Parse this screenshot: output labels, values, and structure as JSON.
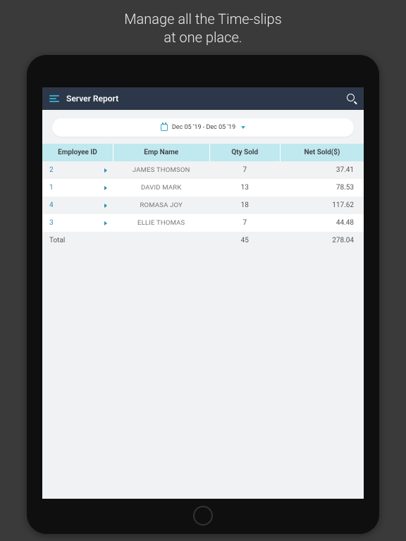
{
  "promo": {
    "line1": "Manage all the Time-slips",
    "line2": "at one place."
  },
  "topbar": {
    "title": "Server Report"
  },
  "dateRange": {
    "text": "Dec 05 '19 - Dec 05 '19"
  },
  "table": {
    "headers": {
      "id": "Employee ID",
      "name": "Emp Name",
      "qty": "Qty Sold",
      "net": "Net Sold($)"
    },
    "rows": [
      {
        "id": "2",
        "name": "JAMES THOMSON",
        "qty": "7",
        "net": "37.41"
      },
      {
        "id": "1",
        "name": "DAVID MARK",
        "qty": "13",
        "net": "78.53"
      },
      {
        "id": "4",
        "name": "ROMASA JOY",
        "qty": "18",
        "net": "117.62"
      },
      {
        "id": "3",
        "name": "ELLIE THOMAS",
        "qty": "7",
        "net": "44.48"
      }
    ],
    "total": {
      "label": "Total",
      "qty": "45",
      "net": "278.04"
    }
  }
}
